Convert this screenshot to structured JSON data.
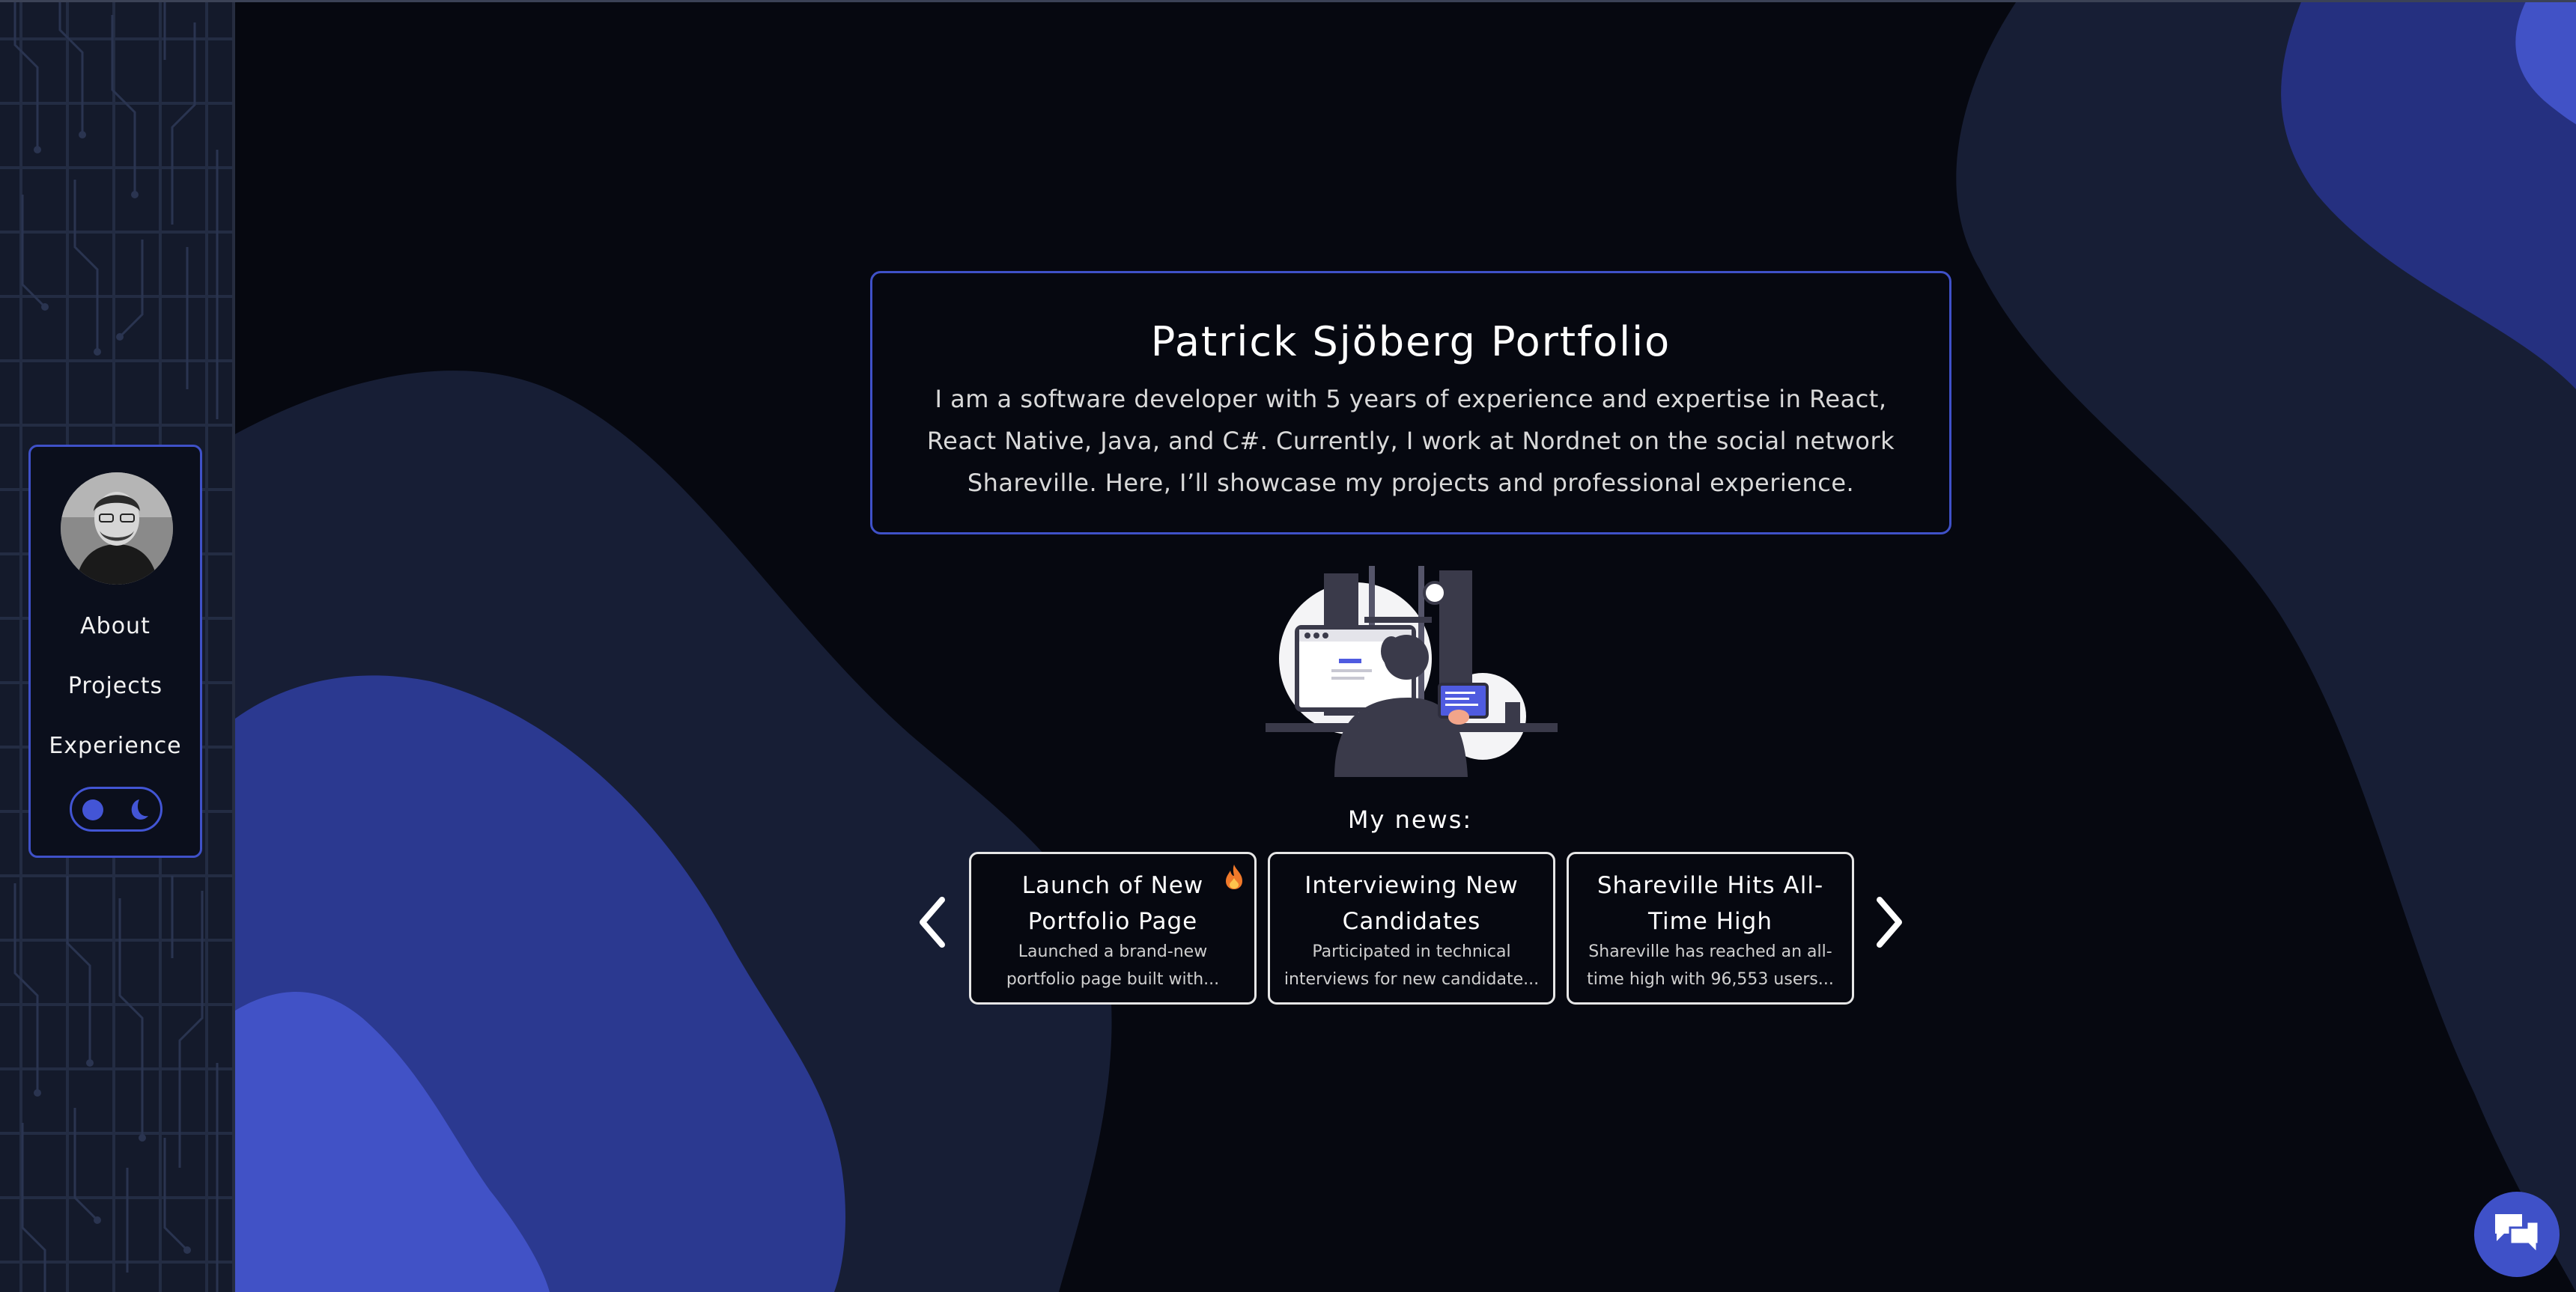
{
  "nav": {
    "items": [
      {
        "label": "About"
      },
      {
        "label": "Projects"
      },
      {
        "label": "Experience"
      }
    ]
  },
  "intro": {
    "title": "Patrick Sjöberg Portfolio",
    "text": "I am a software developer with 5 years of experience and expertise in React, React Native, Java, and C#. Currently, I work at Nordnet on the social network Shareville. Here, I’ll showcase my projects and professional experience."
  },
  "news": {
    "heading": "My news:",
    "cards": [
      {
        "title": "Launch of New Portfolio Page",
        "desc": "Launched a brand-new portfolio page built with...",
        "badge": "fire-icon"
      },
      {
        "title": "Interviewing New Candidates",
        "desc": "Participated in technical interviews for new candidate..."
      },
      {
        "title": "Shareville Hits All-Time High",
        "desc": "Shareville has reached an all-time high with 96,553 users..."
      }
    ]
  },
  "colors": {
    "background": "#060810",
    "accent": "#3f51c8",
    "wave_dark": "#171e35",
    "wave_mid": "#2b3990",
    "wave_light": "#4152c6"
  },
  "icons": {
    "prev": "chevron-left-icon",
    "next": "chevron-right-icon",
    "chat": "chat-icon",
    "theme_light": "sun-dot-icon",
    "theme_dark": "moon-icon"
  }
}
